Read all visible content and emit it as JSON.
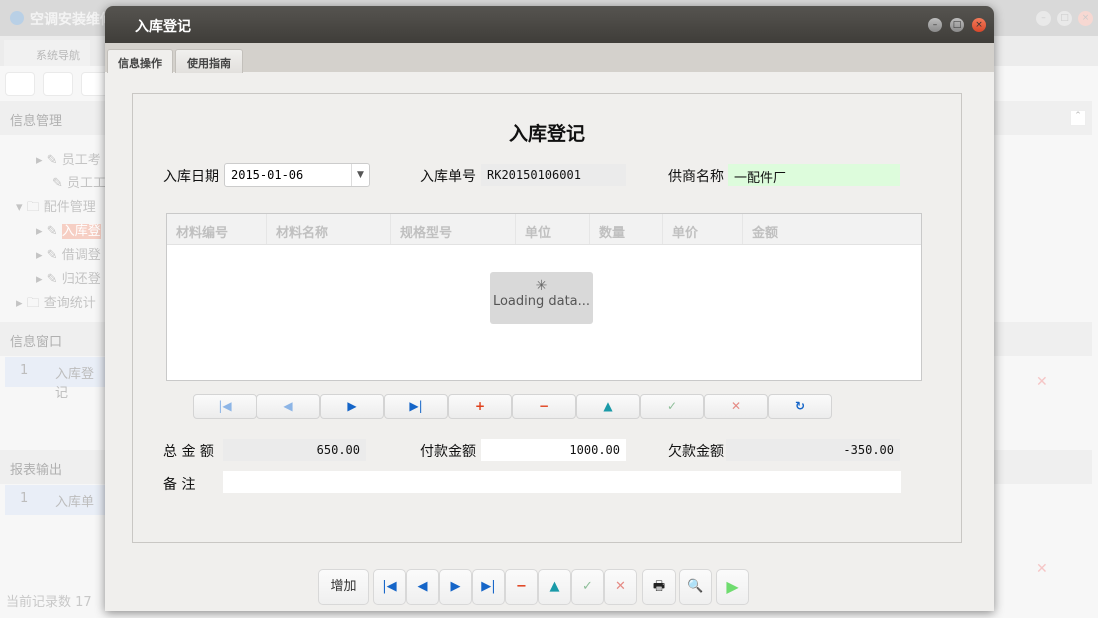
{
  "background_app": {
    "title": "空调安装维修",
    "tab": "系统导航",
    "sections": {
      "info_manage": "信息管理",
      "info_window": "信息窗口",
      "report_output": "报表输出"
    },
    "tree": [
      "员工考",
      "员工工",
      "配件管理",
      "入库登",
      "借调登",
      "归还登",
      "查询统计"
    ],
    "info_window_rows": [
      {
        "no": "1",
        "name": "入库登记"
      }
    ],
    "report_rows": [
      {
        "no": "1",
        "name": "入库单"
      }
    ],
    "status": "当前记录数 17"
  },
  "modal": {
    "title": "入库登记",
    "tabs": [
      "信息操作",
      "使用指南"
    ],
    "heading": "入库登记",
    "form": {
      "date_label": "入库日期",
      "date_value": "2015-01-06",
      "order_label": "入库单号",
      "order_value": "RK20150106001",
      "supplier_label": "供商名称",
      "supplier_value": "一配件厂",
      "total_label": "总 金 额",
      "total_value": "650.00",
      "paid_label": "付款金额",
      "paid_value": "1000.00",
      "owed_label": "欠款金额",
      "owed_value": "-350.00",
      "remark_label": "备 注",
      "remark_value": ""
    },
    "grid": {
      "columns": [
        "材料编号",
        "材料名称",
        "规格型号",
        "单位",
        "数量",
        "单价",
        "金额"
      ],
      "loading": "Loading data..."
    },
    "bottom": {
      "add_label": "增加"
    }
  }
}
